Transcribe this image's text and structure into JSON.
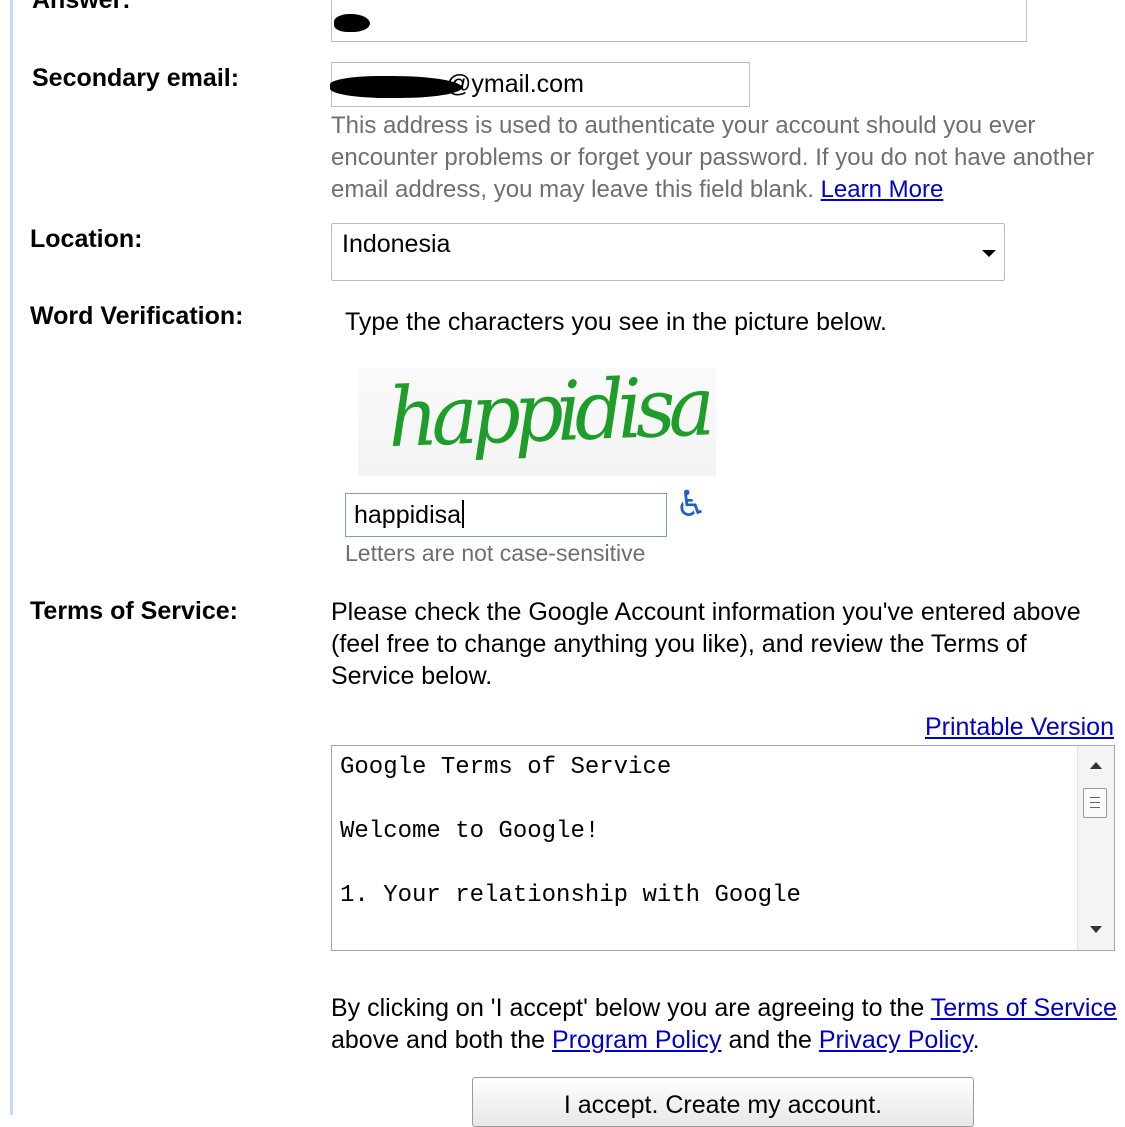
{
  "labels": {
    "answer": "Answer:",
    "secondary_email": "Secondary email:",
    "location": "Location:",
    "word_verification": "Word Verification:",
    "terms_of_service": "Terms of Service:"
  },
  "secondary_email": {
    "domain_visible": "@ymail.com",
    "help_text": "This address is used to authenticate your account should you ever encounter problems or forget your password. If you do not have another email address, you may leave this field blank.",
    "learn_more": "Learn More"
  },
  "location": {
    "selected": "Indonesia"
  },
  "word_verification": {
    "prompt": "Type the characters you see in the picture below.",
    "captcha_word": "happidisa",
    "input_value": "happidisa",
    "case_note": "Letters are not case-sensitive"
  },
  "terms": {
    "intro": "Please check the Google Account information you've entered above (feel free to change anything you like), and review the Terms of Service below.",
    "printable_version": "Printable Version",
    "box_lines": [
      "Google Terms of Service",
      "",
      "Welcome to Google!",
      "",
      "1. Your relationship with Google"
    ]
  },
  "agreement": {
    "prefix": "By clicking on 'I accept' below you are agreeing to the ",
    "terms_link": "Terms of Service",
    "middle": " above and both the ",
    "program_policy": "Program Policy",
    "and_the": " and the ",
    "privacy_policy": "Privacy Policy",
    "suffix": "."
  },
  "accept_button": "I accept. Create my account.",
  "colors": {
    "link": "#0000cc",
    "captcha_green": "#1f9d2a",
    "accessibility_blue": "#1f5fbf",
    "left_rule": "#c3d9ff"
  }
}
